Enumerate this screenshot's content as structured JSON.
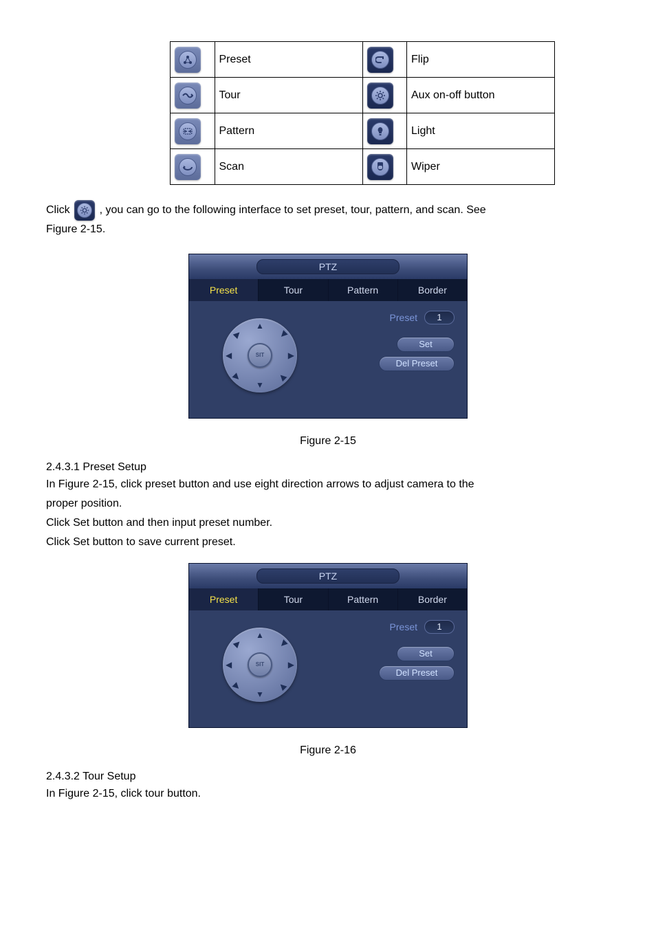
{
  "icon_table": {
    "rows": [
      {
        "left_name": "preset-icon",
        "left_text": "Preset",
        "right_name": "flip-icon",
        "right_text": "Flip"
      },
      {
        "left_name": "tour-icon",
        "left_text": "Tour",
        "right_name": "aux-set-icon",
        "right_text": "Aux on-off button"
      },
      {
        "left_name": "pattern-icon",
        "left_text": "Pattern",
        "right_name": "light-icon",
        "right_text": "Light"
      },
      {
        "left_name": "scan-icon",
        "left_text": "Scan",
        "right_name": "wiper-icon",
        "right_text": "Wiper"
      }
    ]
  },
  "intro_text": {
    "click": "Click ",
    "rest": ", you can go to the following interface to set preset, tour, pattern, and scan. See",
    "figref": "Figure 2-15."
  },
  "ptz": {
    "title": "PTZ",
    "tabs": {
      "preset": "Preset",
      "tour": "Tour",
      "pattern": "Pattern",
      "border": "Border"
    },
    "preset_label": "Preset",
    "preset_value": "1",
    "btn_set": "Set",
    "btn_del": "Del Preset",
    "sit": "SIT"
  },
  "captions": {
    "fig15": "Figure 2-15"
  },
  "preset_section": {
    "heading": "2.4.3.1 Preset Setup",
    "line1": "In Figure 2-15, click preset button and use eight direction arrows to adjust camera to the",
    "line2": "proper position.",
    "line3": "Click Set button and then input preset number.",
    "line4": "Click Set button to save current preset."
  },
  "captions2": {
    "fig16": "Figure 2-16"
  },
  "tour_section": {
    "heading": "2.4.3.2 Tour Setup",
    "line1": "In Figure 2-15, click tour button."
  }
}
